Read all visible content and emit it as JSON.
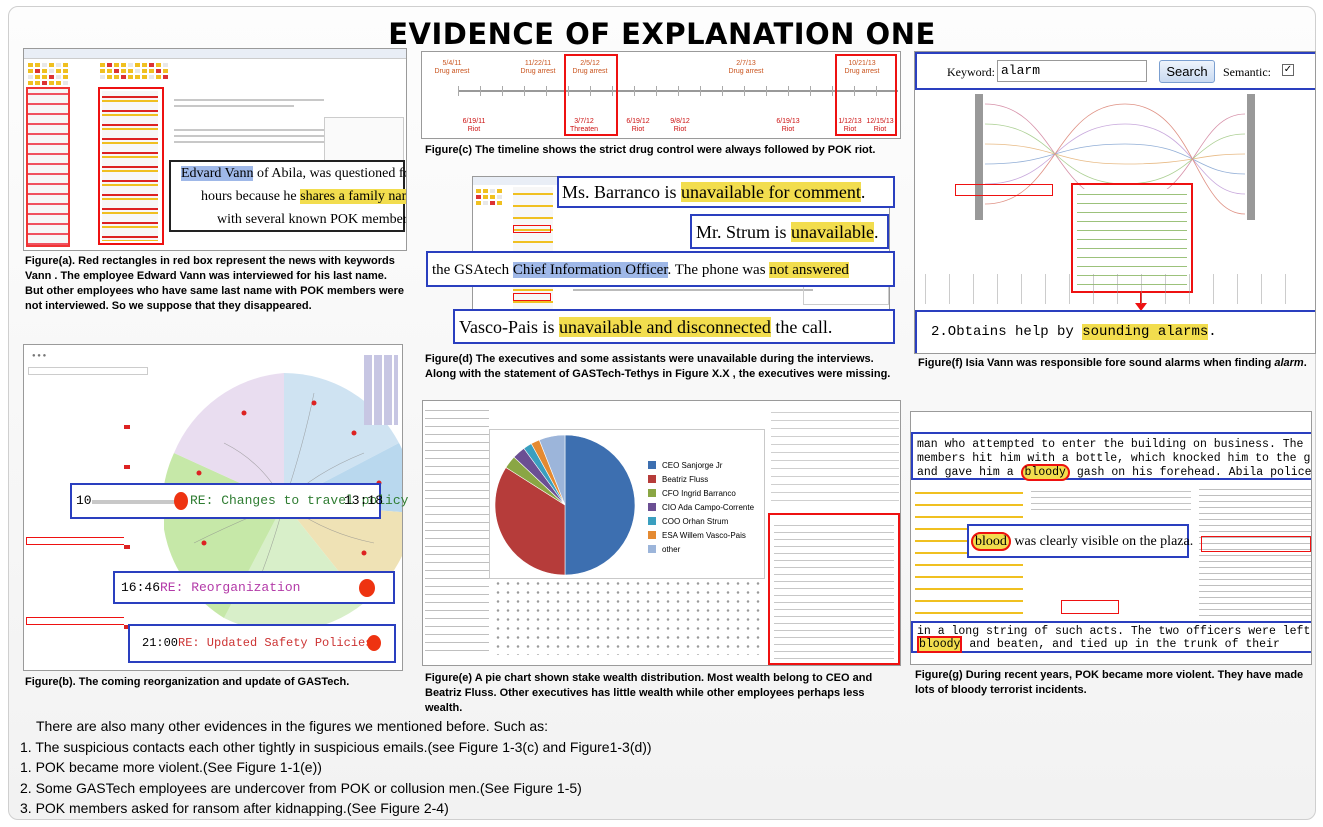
{
  "title": "EVIDENCE OF EXPLANATION ONE",
  "fig_a": {
    "caption": "Figure(a). Red rectangles in red box represent the news with keywords Vann . The employee Edward Vann was interviewed for his last name. But other employees who have same last name with POK members were not interviewed. So we suppose that they disappeared.",
    "quote_1": "Edvard Vann",
    "quote_2": " of Abila, was questioned for",
    "quote_3": "hours because he ",
    "quote_4": "shares a family name",
    "quote_5": "with several known POK members."
  },
  "fig_b": {
    "caption": "Figure(b). The coming reorganization and update of GASTech.",
    "row1_num": "10",
    "row1_label": "RE: Changes to travel policy",
    "row1_time": "13:18",
    "row2_time": "16:46",
    "row2_label": "RE: Reorganization",
    "row3_time": "21:00",
    "row3_label": "RE: Updated Safety Policies"
  },
  "fig_c": {
    "caption": "Figure(c) The timeline shows the strict drug control were always followed by POK riot.",
    "top_events": [
      {
        "date": "5/4/11",
        "label": "Drug arrest"
      },
      {
        "date": "11/22/11",
        "label": "Drug arrest"
      },
      {
        "date": "2/5/12",
        "label": "Drug arrest"
      },
      {
        "date": "2/7/13",
        "label": "Drug arrest"
      },
      {
        "date": "10/21/13",
        "label": "Drug arrest"
      }
    ],
    "bottom_events": [
      {
        "date": "6/19/11",
        "label": "Riot"
      },
      {
        "date": "3/7/12",
        "label": "Threaten"
      },
      {
        "date": "6/19/12",
        "label": "Riot"
      },
      {
        "date": "9/8/12",
        "label": "Riot"
      },
      {
        "date": "6/19/13",
        "label": "Riot"
      },
      {
        "date": "1/12/13",
        "label": "Riot"
      },
      {
        "date": "12/15/13",
        "label": "Riot"
      }
    ]
  },
  "fig_d": {
    "caption_1": "Figure(d) The executives and some assistants were unavailable during the interviews.",
    "caption_2": "Along with the statement of GASTech-Tethys in Figure X.X , the executives were missing.",
    "q1a": "Ms. Barranco is ",
    "q1b": "unavailable for comment",
    "q1c": ".",
    "q2a": "Mr. Strum is ",
    "q2b": "unavailable",
    "q2c": ".",
    "q3a": "the GSAtech ",
    "q3b": "Chief Information Officer",
    "q3c": ".  The phone was ",
    "q3d": "not answered",
    "q4a": "Vasco-Pais is ",
    "q4b": "unavailable and disconnected",
    "q4c": " the call."
  },
  "fig_e": {
    "caption": "Figure(e) A pie chart shown stake wealth distribution. Most wealth belong to CEO and Beatriz Fluss. Other executives has little wealth while other employees perhaps less wealth.",
    "legend": [
      "CEO Sanjorge Jr",
      "Beatriz Fluss",
      "CFO Ingrid Barranco",
      "CIO Ada Campo-Corrente",
      "COO Orhan Strum",
      "ESA Willem Vasco-Pais",
      "other"
    ]
  },
  "fig_f": {
    "caption_prefix": "Figure(f)  Isia Vann was responsible fore sound alarms when finding ",
    "caption_em": "alarm",
    "caption_suffix": ".",
    "keyword_label": "Keyword:",
    "keyword_value": "alarm",
    "search_label": "Search",
    "semantic_label": "Semantic:",
    "result_a": "2.Obtains help by ",
    "result_b": "sounding alarms",
    "result_c": "."
  },
  "fig_g": {
    "caption": "Figure(g) During recent years, POK became more violent. They have made lots of bloody terrorist incidents.",
    "text_1": "man who attempted to enter the building on business. The POK",
    "text_2": "members hit him with a bottle, which knocked him to the ground",
    "text_3a": "and gave him a ",
    "text_3b": "bloody",
    "text_3c": " gash on his forehead. Abila police",
    "mid_a": "blood",
    "mid_b": " was clearly visible on the plaza.",
    "bot_1": "in a long string of such acts. The two officers were left",
    "bot_2a": "bloody",
    "bot_2b": " and beaten, and tied up in the trunk of their"
  },
  "bottom_text": [
    "There are also many other evidences in the figures we mentioned before. Such as:",
    "1. The suspicious contacts each other tightly in suspicious emails.(see Figure 1-3(c) and Figure1-3(d))",
    "1. POK became more violent.(See Figure 1-1(e))",
    "2. Some GASTech employees are undercover from POK or collusion men.(See Figure 1-5)",
    "3. POK members asked for ransom after kidnapping.(See Figure 2-4)"
  ],
  "chart_data": {
    "type": "pie",
    "title": "",
    "categories": [
      "CEO Sanjorge Jr",
      "Beatriz Fluss",
      "CFO Ingrid Barranco",
      "CIO Ada Campo-Corrente",
      "COO Orhan Strum",
      "ESA Willem Vasco-Pais",
      "other"
    ],
    "values": [
      50,
      34,
      3,
      3,
      2,
      2,
      6
    ],
    "colors": [
      "#3d6fb0",
      "#b63c3a",
      "#8aa644",
      "#6b4f93",
      "#3a9fbf",
      "#e48a32",
      "#9cb5da"
    ]
  }
}
